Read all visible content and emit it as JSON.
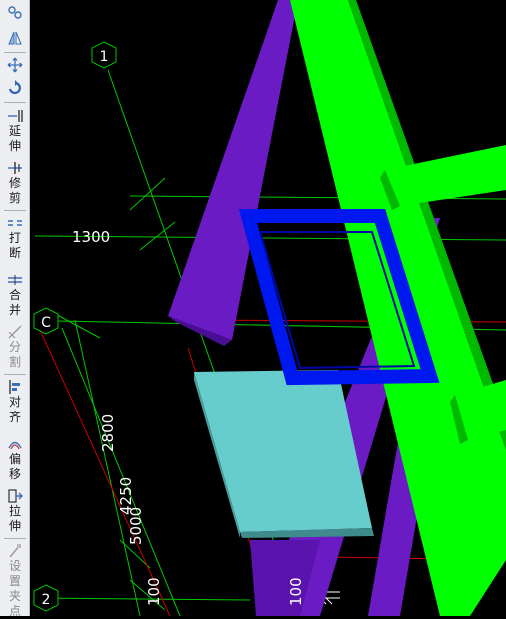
{
  "toolbar": {
    "tools": [
      {
        "id": "rotate",
        "icon": "rotate-small-icon",
        "label": ""
      },
      {
        "id": "mirror",
        "icon": "mirror-icon",
        "label": ""
      },
      {
        "id": "move",
        "icon": "move-arrows-icon",
        "label": ""
      },
      {
        "id": "rotate2",
        "icon": "rotate-icon",
        "label": ""
      },
      {
        "id": "extend",
        "icon": "extend-icon",
        "label": "延\n伸"
      },
      {
        "id": "trim",
        "icon": "trim-icon",
        "label": "修\n剪"
      },
      {
        "id": "break",
        "icon": "break-icon",
        "label": "打\n断"
      },
      {
        "id": "merge",
        "icon": "merge-icon",
        "label": "合\n并"
      },
      {
        "id": "split",
        "icon": "split-icon",
        "label": "分\n割"
      },
      {
        "id": "align",
        "icon": "align-icon",
        "label": "对\n齐"
      },
      {
        "id": "offset",
        "icon": "offset-icon",
        "label": "偏\n移"
      },
      {
        "id": "stretch",
        "icon": "stretch-icon",
        "label": "拉\n伸"
      },
      {
        "id": "grip",
        "icon": "grip-icon",
        "label": "设\n置\n夹\n点"
      }
    ]
  },
  "viewport": {
    "axis_labels": {
      "axis_1": "1",
      "axis_c": "C",
      "axis_2": "2"
    },
    "dimensions": {
      "d1300": "1300",
      "d2800": "2800",
      "d4250": "4250",
      "d5000": "5000",
      "d100a": "100",
      "d100b": "100"
    },
    "colors": {
      "background": "#000000",
      "beam_green": "#00ff00",
      "beam_purple": "#6a1bc4",
      "frame_blue": "#0012ee",
      "slab_cyan": "#66cccc",
      "grid_line": "#00c800",
      "dim_line": "#cc0000"
    }
  }
}
